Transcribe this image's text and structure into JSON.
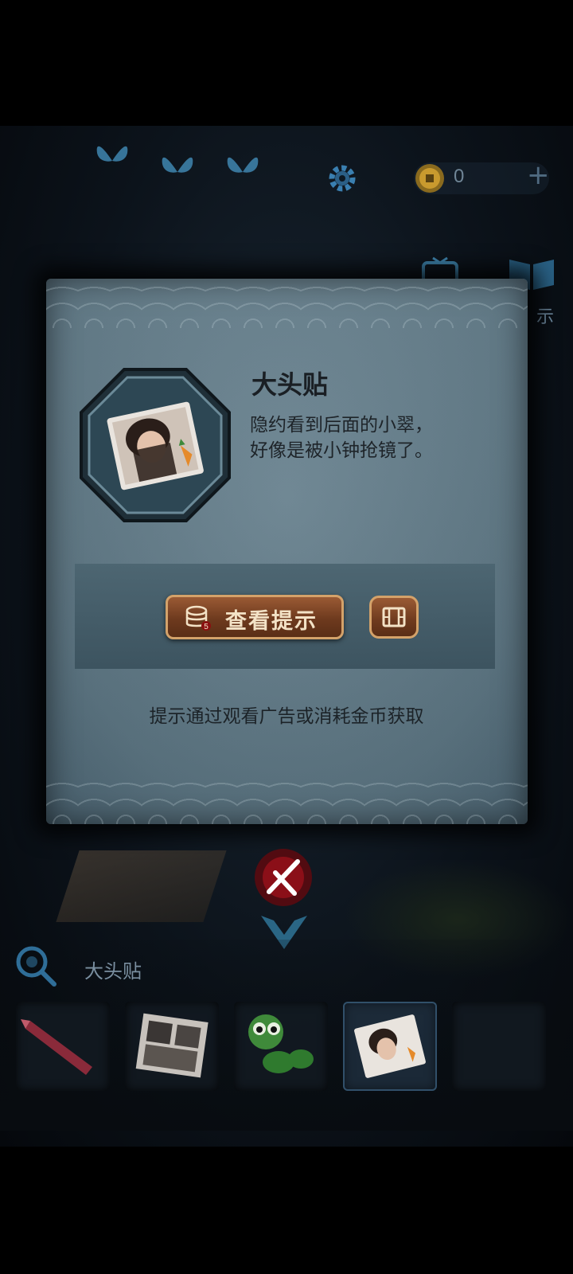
{
  "hud": {
    "coin_count": "0",
    "plus_symbol": "+",
    "side_label": "示",
    "icons": [
      "butterfly-icon",
      "butterfly-icon",
      "butterfly-icon",
      "gear-icon",
      "coin-icon",
      "plus-icon",
      "tv-icon",
      "book-icon"
    ]
  },
  "dialog": {
    "item_title": "大头贴",
    "description_lines": [
      "隐约看到后面的小翠，",
      "好像是被小钟抢镜了。"
    ],
    "hint_button_label": "查看提示",
    "hint_cost_badge": "5",
    "hint_note": "提示通过观看广告或消耗金币获取",
    "colors": {
      "panel": "#5f7885",
      "button": "#7a4222",
      "button_border": "#d4a26a",
      "close_accent": "#8b0f18"
    }
  },
  "inventory": {
    "selected_label": "大头贴",
    "slots": [
      {
        "item": "crayon",
        "selected": false
      },
      {
        "item": "photo-sheet",
        "selected": false
      },
      {
        "item": "green-toy-caterpillar",
        "selected": false
      },
      {
        "item": "photo-sticker",
        "selected": true
      },
      {
        "item": "empty",
        "selected": false
      }
    ]
  }
}
